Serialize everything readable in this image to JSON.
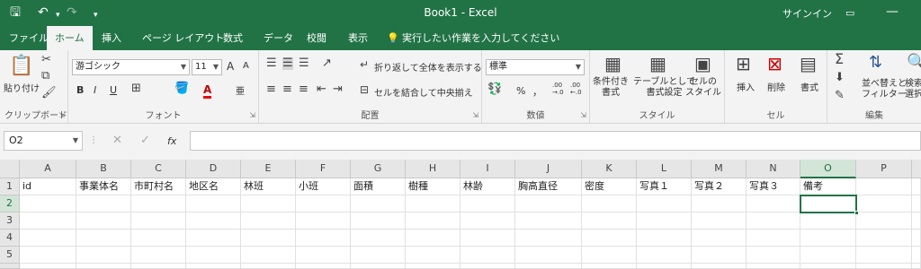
{
  "window": {
    "title": "Book1 - Excel",
    "signin": "サインイン"
  },
  "quick_access": {
    "save_icon": "save-icon",
    "undo_icon": "undo-icon",
    "redo_icon": "redo-icon"
  },
  "tabs": [
    "ファイル",
    "ホーム",
    "挿入",
    "ページ レイアウト",
    "数式",
    "データ",
    "校閲",
    "表示"
  ],
  "tellme": "実行したい作業を入力してください",
  "ribbon": {
    "clipboard": {
      "paste": "貼り付け",
      "label": "クリップボード"
    },
    "font": {
      "name": "游ゴシック",
      "size": "11",
      "grow": "A",
      "shrink": "A",
      "bold": "B",
      "italic": "I",
      "underline": "U",
      "font_color_letter": "A",
      "phonetic": "亜",
      "label": "フォント"
    },
    "alignment": {
      "wrap": "折り返して全体を表示する",
      "merge": "セルを結合して中央揃え",
      "label": "配置"
    },
    "number": {
      "format": "標準",
      "percent": "%",
      "comma": "，",
      "inc": ".00\n→.0",
      "dec": ".00\n←.0",
      "label": "数値"
    },
    "styles": {
      "conditional": "条件付き\n書式",
      "table": "テーブルとして\n書式設定",
      "cell": "セルの\nスタイル",
      "label": "スタイル"
    },
    "cells": {
      "insert": "挿入",
      "delete": "削除",
      "format": "書式",
      "label": "セル"
    },
    "editing": {
      "sort": "並べ替えと\nフィルター",
      "find": "検索と\n選択",
      "label": "編集"
    }
  },
  "formula_bar": {
    "name_box": "O2",
    "fx": "fx",
    "value": ""
  },
  "sheet": {
    "columns": [
      "A",
      "B",
      "C",
      "D",
      "E",
      "F",
      "G",
      "H",
      "I",
      "J",
      "K",
      "L",
      "M",
      "N",
      "O",
      "P"
    ],
    "rows": [
      "1",
      "2",
      "3",
      "4",
      "5"
    ],
    "row1": [
      "id",
      "事業体名",
      "市町村名",
      "地区名",
      "林班",
      "小班",
      "面積",
      "樹種",
      "林齢",
      "胸高直径",
      "密度",
      "写真１",
      "写真２",
      "写真３",
      "備考",
      ""
    ],
    "selected_cell": "O2"
  }
}
